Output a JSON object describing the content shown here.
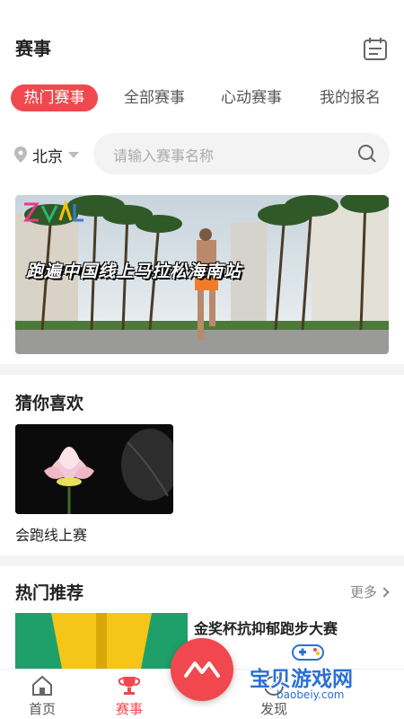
{
  "header": {
    "title": "赛事"
  },
  "tabs": [
    {
      "label": "热门赛事",
      "active": true
    },
    {
      "label": "全部赛事",
      "active": false
    },
    {
      "label": "心动赛事",
      "active": false
    },
    {
      "label": "我的报名",
      "active": false
    }
  ],
  "location": {
    "city": "北京"
  },
  "search": {
    "placeholder": "请输入赛事名称"
  },
  "banner": {
    "text": "跑遍中国线上马拉松海南站"
  },
  "guess": {
    "title": "猜你喜欢",
    "items": [
      {
        "label": "会跑线上赛"
      }
    ]
  },
  "hot": {
    "title": "热门推荐",
    "more_label": "更多",
    "items": [
      {
        "title": "金奖杯抗抑郁跑步大赛"
      }
    ]
  },
  "bottom_nav": [
    {
      "label": "首页",
      "icon": "home-icon",
      "active": false
    },
    {
      "label": "赛事",
      "icon": "trophy-icon",
      "active": true
    },
    {
      "label": "发现",
      "icon": "discover-icon",
      "active": false
    }
  ],
  "watermark": {
    "text": "宝贝游戏网",
    "url": "baobeiy.com"
  },
  "colors": {
    "accent": "#f0484e",
    "watermark": "#2a6fd6"
  }
}
